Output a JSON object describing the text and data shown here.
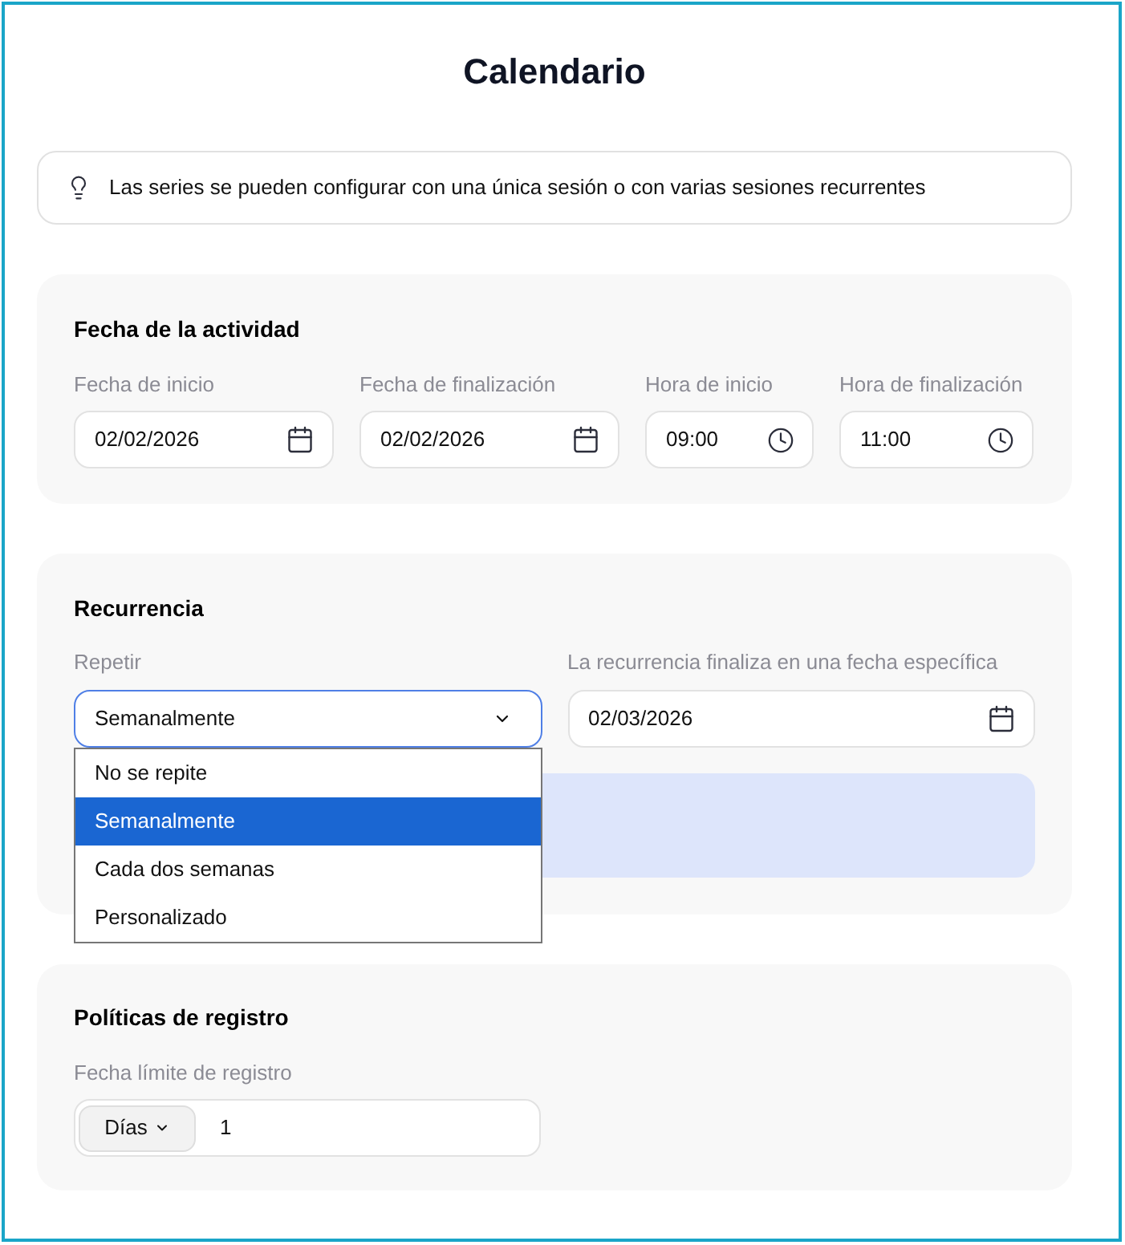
{
  "page": {
    "title": "Calendario"
  },
  "tip": {
    "text": "Las series se pueden configurar con una única sesión o con varias sesiones recurrentes"
  },
  "activity_date": {
    "heading": "Fecha de la actividad",
    "fields": [
      {
        "kind": "date",
        "label": "Fecha de inicio",
        "value": "02/02/2026"
      },
      {
        "kind": "date",
        "label": "Fecha de finalización",
        "value": "02/02/2026"
      },
      {
        "kind": "time",
        "label": "Hora de inicio",
        "value": "09:00"
      },
      {
        "kind": "time",
        "label": "Hora de finalización",
        "value": "11:00"
      }
    ]
  },
  "recurrence": {
    "heading": "Recurrencia",
    "repeat": {
      "label": "Repetir",
      "value": "Semanalmente",
      "expanded": true,
      "options": [
        {
          "label": "No se repite",
          "selected": false
        },
        {
          "label": "Semanalmente",
          "selected": true
        },
        {
          "label": "Cada dos semanas",
          "selected": false
        },
        {
          "label": "Personalizado",
          "selected": false
        }
      ]
    },
    "end_date": {
      "kind": "date",
      "label": "La recurrencia finaliza en una fecha específica",
      "value": "02/03/2026"
    }
  },
  "registration": {
    "heading": "Políticas de registro",
    "deadline": {
      "label": "Fecha límite de registro",
      "unit": "Días",
      "value": "1"
    }
  }
}
